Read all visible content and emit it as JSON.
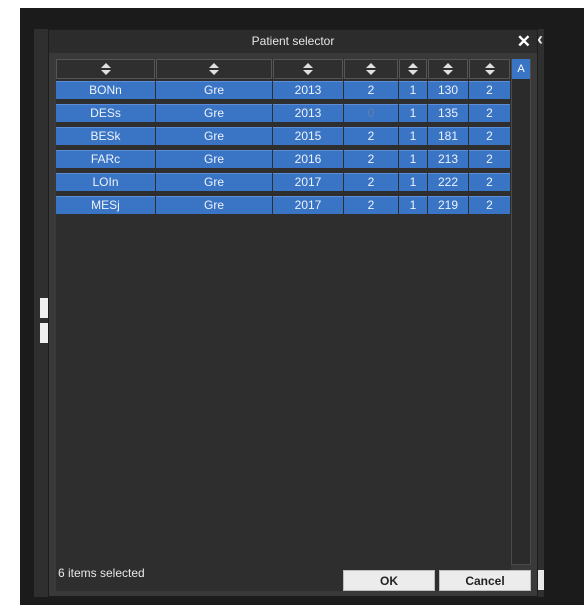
{
  "dialog": {
    "title": "Patient selector",
    "close_glyph": "✕",
    "a_label": "A",
    "status_text": "6 items selected",
    "ok_label": "OK",
    "cancel_label": "Cancel"
  },
  "background": {
    "back_glyph": "‹"
  },
  "icons": {
    "sort": "sort-both-icon",
    "close": "close-icon"
  },
  "colors": {
    "dialog_bg": "#393939",
    "selection": "#3a74c4",
    "titlebar": "#2c2c2c"
  },
  "columns": [
    "",
    "",
    "",
    "",
    "",
    "",
    ""
  ],
  "rows": [
    {
      "name": "BONn",
      "site": "Gre",
      "year": "2013",
      "c4": "2",
      "c5": "1",
      "c6": "130",
      "c7": "2"
    },
    {
      "name": "DESs",
      "site": "Gre",
      "year": "2013",
      "c4": "0",
      "c5": "1",
      "c6": "135",
      "c7": "2",
      "dim_c4": true
    },
    {
      "name": "BESk",
      "site": "Gre",
      "year": "2015",
      "c4": "2",
      "c5": "1",
      "c6": "181",
      "c7": "2"
    },
    {
      "name": "FARc",
      "site": "Gre",
      "year": "2016",
      "c4": "2",
      "c5": "1",
      "c6": "213",
      "c7": "2"
    },
    {
      "name": "LOIn",
      "site": "Gre",
      "year": "2017",
      "c4": "2",
      "c5": "1",
      "c6": "222",
      "c7": "2"
    },
    {
      "name": "MESj",
      "site": "Gre",
      "year": "2017",
      "c4": "2",
      "c5": "1",
      "c6": "219",
      "c7": "2"
    }
  ]
}
